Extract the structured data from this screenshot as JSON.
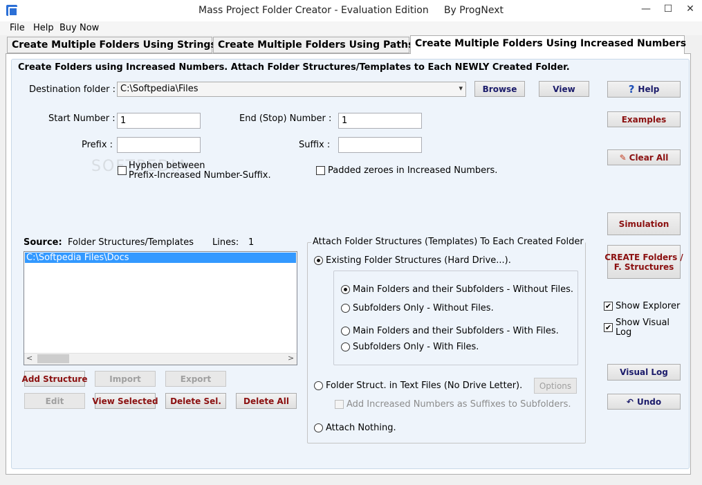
{
  "window": {
    "title": "Mass Project Folder Creator - Evaluation Edition     By ProgNext",
    "minimize": "—",
    "maximize": "☐",
    "close": "✕"
  },
  "menu": [
    "File",
    "Help",
    "Buy Now"
  ],
  "tabs": [
    {
      "label": "Create Multiple Folders Using Strings"
    },
    {
      "label": "Create Multiple Folders Using Paths"
    },
    {
      "label": "Create Multiple Folders Using Increased Numbers"
    }
  ],
  "header": "Create Folders using Increased Numbers. Attach Folder Structures/Templates to Each NEWLY Created Folder.",
  "destination": {
    "label": "Destination folder :",
    "value": "C:\\Softpedia\\Files",
    "browse": "Browse",
    "view": "View"
  },
  "fields": {
    "start_label": "Start Number :",
    "start_value": "1",
    "end_label": "End (Stop) Number :",
    "end_value": "1",
    "prefix_label": "Prefix :",
    "prefix_value": "",
    "suffix_label": "Suffix :",
    "suffix_value": ""
  },
  "options": {
    "hyphen_line1": "Hyphen between",
    "hyphen_line2": "Prefix-Increased Number-Suffix.",
    "padded": "Padded zeroes in Increased Numbers."
  },
  "source": {
    "label": "Source:",
    "title": "Folder Structures/Templates",
    "lines_label": "Lines:",
    "lines_value": "1",
    "items": [
      "C:\\Softpedia Files\\Docs"
    ]
  },
  "list_buttons": {
    "add": "Add Structure",
    "import": "Import",
    "export": "Export",
    "edit": "Edit",
    "view_selected": "View Selected",
    "delete_sel": "Delete Sel.",
    "delete_all": "Delete All"
  },
  "attach": {
    "title": "Attach Folder Structures (Templates) To Each Created Folder",
    "existing": "Existing Folder Structures (Hard Drive...).",
    "main_without": "Main Folders and their Subfolders - Without Files.",
    "sub_without": "Subfolders Only - Without Files.",
    "main_with": "Main Folders and their Subfolders - With Files.",
    "sub_with": "Subfolders Only - With Files.",
    "text_files": "Folder Struct. in Text Files (No Drive Letter).",
    "options": "Options",
    "add_increased": "Add Increased Numbers as Suffixes to Subfolders.",
    "nothing": "Attach Nothing."
  },
  "right_buttons": {
    "help": "Help",
    "examples": "Examples",
    "clear_all": "Clear All",
    "simulation": "Simulation",
    "create_line1": "CREATE Folders /",
    "create_line2": "F. Structures",
    "visual_log": "Visual Log",
    "undo": "Undo"
  },
  "right_checks": {
    "show_explorer": "Show Explorer",
    "show_visual_log_1": "Show Visual",
    "show_visual_log_2": "Log"
  },
  "watermark": "SOFTPEDIA"
}
